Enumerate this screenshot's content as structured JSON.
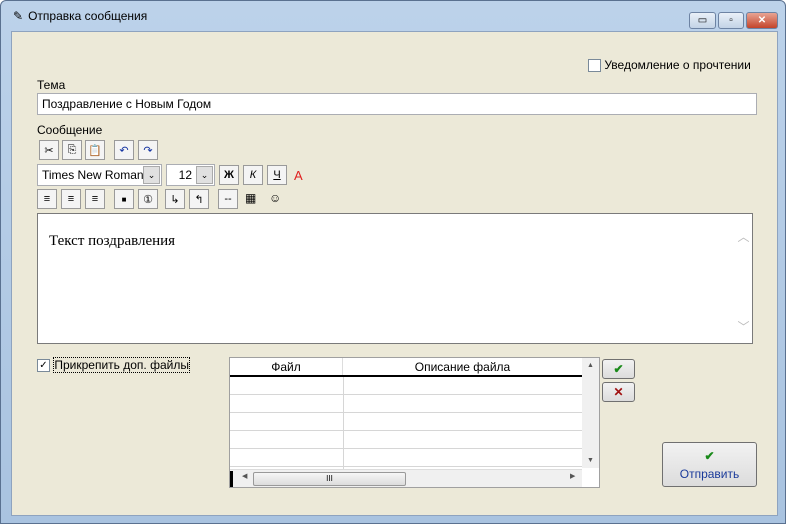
{
  "window": {
    "title": "Отправка сообщения",
    "controls": [
      "minimize",
      "maximize",
      "close"
    ]
  },
  "read_receipt": {
    "label": "Уведомление о прочтении",
    "checked": false
  },
  "subject": {
    "label": "Тема",
    "value": "Поздравление с Новым Годом"
  },
  "message": {
    "label": "Сообщение",
    "body": "Текст поздравления"
  },
  "toolbar": {
    "font": "Times New Roman",
    "size": "12",
    "bold": "Ж",
    "italic": "К",
    "underline": "Ч",
    "color": "A",
    "separator": "--"
  },
  "attach": {
    "label": "Прикрепить доп. файлы",
    "checked": true
  },
  "files": {
    "columns": [
      "Файл",
      "Описание файла"
    ],
    "rows": [
      [
        "",
        ""
      ],
      [
        "",
        ""
      ],
      [
        "",
        ""
      ],
      [
        "",
        ""
      ],
      [
        "",
        ""
      ]
    ],
    "scroll_thumb": "III"
  },
  "send": {
    "label": "Отправить"
  },
  "colors": {
    "accent": "#1a8a1a",
    "delete": "#a01010"
  }
}
